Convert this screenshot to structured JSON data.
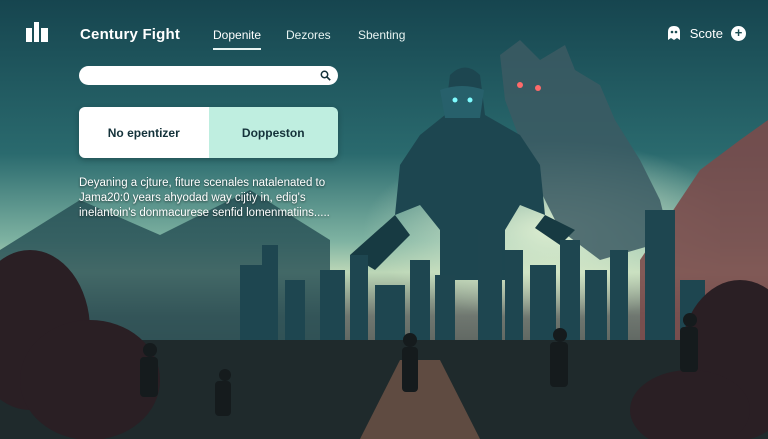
{
  "header": {
    "title": "Century Fight",
    "nav": [
      "Dopenite",
      "Dezores",
      "Sbenting"
    ],
    "active_nav": "Dopenite",
    "score_label": "Scote"
  },
  "search": {
    "placeholder": "",
    "value": ""
  },
  "toggle": {
    "option_a": "No epentizer",
    "option_b": "Doppeston"
  },
  "description": {
    "line1": "Deyaning a cjture, fiture scenales natalenated  to",
    "line2": "Jama20:0 years ahyodad way cijtiy in, edig's",
    "line3": "inelantoin's donmacurese senfid lomenmatiins....."
  },
  "colors": {
    "accent": "#bfeee0",
    "bg_dark": "#123c46",
    "text": "#ffffff"
  },
  "icons": [
    "app-logo-icon",
    "search-icon",
    "ghost-icon",
    "plus-icon"
  ]
}
